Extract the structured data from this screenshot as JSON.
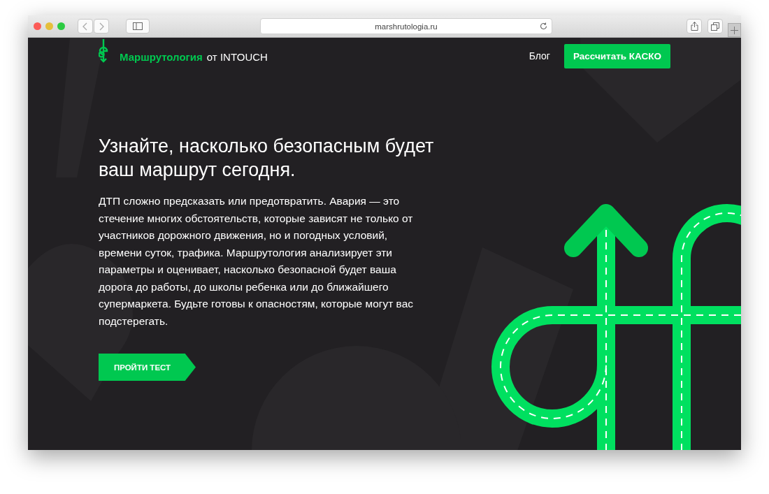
{
  "browser": {
    "address": "marshrutologia.ru"
  },
  "header": {
    "brand": "Маршрутология",
    "brand_suffix": "от INTOUCH",
    "nav": [
      {
        "label": "Блог",
        "kind": "link"
      },
      {
        "label": "Рассчитать КАСКО",
        "kind": "button"
      }
    ]
  },
  "hero": {
    "title": "Узнайте, насколько безопасным будет ваш маршрут сегодня.",
    "text": "ДТП сложно предсказать или предотвратить. Авария — это стечение многих обстоятельств, которые зависят не только от участников дорожного движения, но и погодных условий, времени суток, трафика. Маршрутология анализирует эти параметры и оценивает, насколько безопасной будет ваша дорога до работы, до школы ребенка или до ближайшего супермаркета. Будьте готовы к опасностям, которые могут вас подстерегать.",
    "button": "ПРОЙТИ ТЕСТ"
  }
}
